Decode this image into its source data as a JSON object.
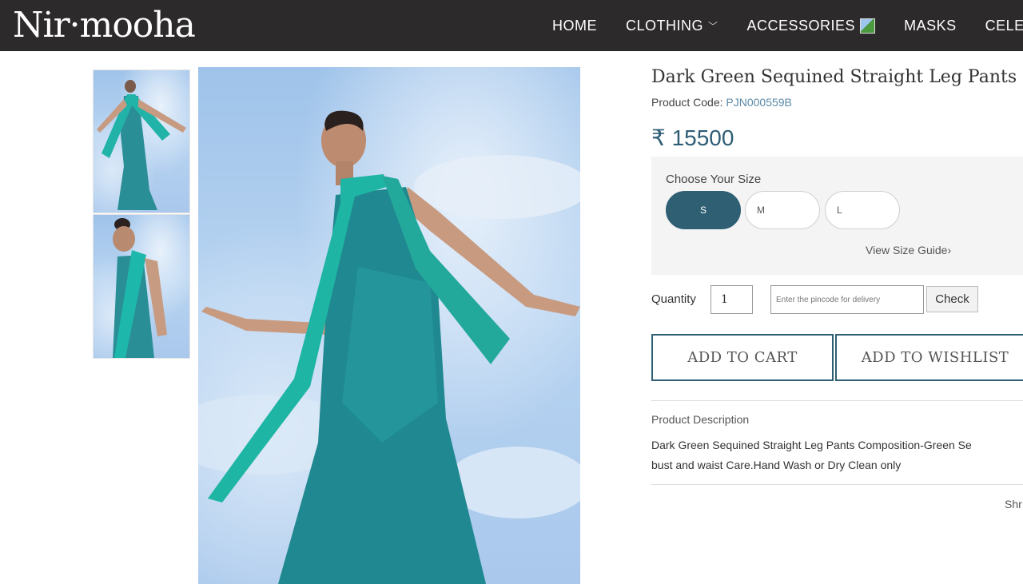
{
  "brand": {
    "logo_text": "Nir·mooha"
  },
  "nav": {
    "items": [
      {
        "label": "HOME"
      },
      {
        "label": "CLOTHING",
        "icon": "chevron-down-icon"
      },
      {
        "label": "ACCESSORIES",
        "icon": "image-icon"
      },
      {
        "label": "MASKS"
      },
      {
        "label": "CELEBR"
      }
    ]
  },
  "product": {
    "title": "Dark Green Sequined Straight Leg Pants",
    "code_label": "Product Code:",
    "code_value": "PJN000559B",
    "price": "₹ 15500"
  },
  "size": {
    "label": "Choose Your Size",
    "options": [
      "S",
      "M",
      "L"
    ],
    "selected": "S",
    "guide_link": "View Size Guide›"
  },
  "purchase": {
    "quantity_label": "Quantity",
    "quantity_value": "1",
    "pincode_placeholder": "Enter the pincode for delivery",
    "check_label": "Check",
    "add_to_cart": "ADD TO CART",
    "add_to_wishlist": "ADD TO WISHLIST"
  },
  "description": {
    "heading": "Product Description",
    "line1": "Dark Green Sequined Straight Leg Pants Composition-Green Se",
    "line2": "bust and waist Care.Hand Wash or Dry Clean only"
  },
  "share": {
    "label": "Shr"
  },
  "colors": {
    "header_bg": "#2d2a2b",
    "accent": "#2f5f73",
    "price": "#2e5d75",
    "garment": "#1e8f94"
  }
}
